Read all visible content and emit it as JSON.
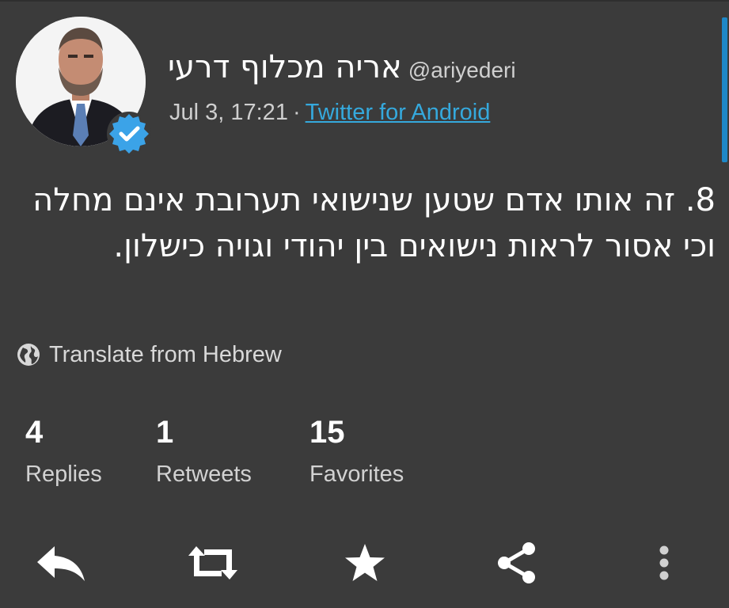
{
  "tweet": {
    "display_name": "אריה מכלוף דרעי",
    "handle": "@ariyederi",
    "timestamp": "Jul 3, 17:21",
    "separator": "·",
    "source": "Twitter for Android",
    "verified": true,
    "text": "8. זה אותו אדם שטען שנישואי תערובת אינם מחלה וכי אסור לראות נישואים בין יהודי וגויה כישלון.",
    "translate_label": "Translate from Hebrew"
  },
  "stats": [
    {
      "count": "4",
      "label": "Replies"
    },
    {
      "count": "1",
      "label": "Retweets"
    },
    {
      "count": "15",
      "label": "Favorites"
    }
  ],
  "actions": [
    {
      "icon": "reply-icon"
    },
    {
      "icon": "retweet-icon"
    },
    {
      "icon": "favorite-star-icon"
    },
    {
      "icon": "share-icon"
    },
    {
      "icon": "more-vertical-icon"
    }
  ],
  "colors": {
    "background": "#3b3b3b",
    "link": "#35a9dd",
    "verified_badge": "#3ba3e8",
    "scrollbar": "#1e88c8"
  }
}
